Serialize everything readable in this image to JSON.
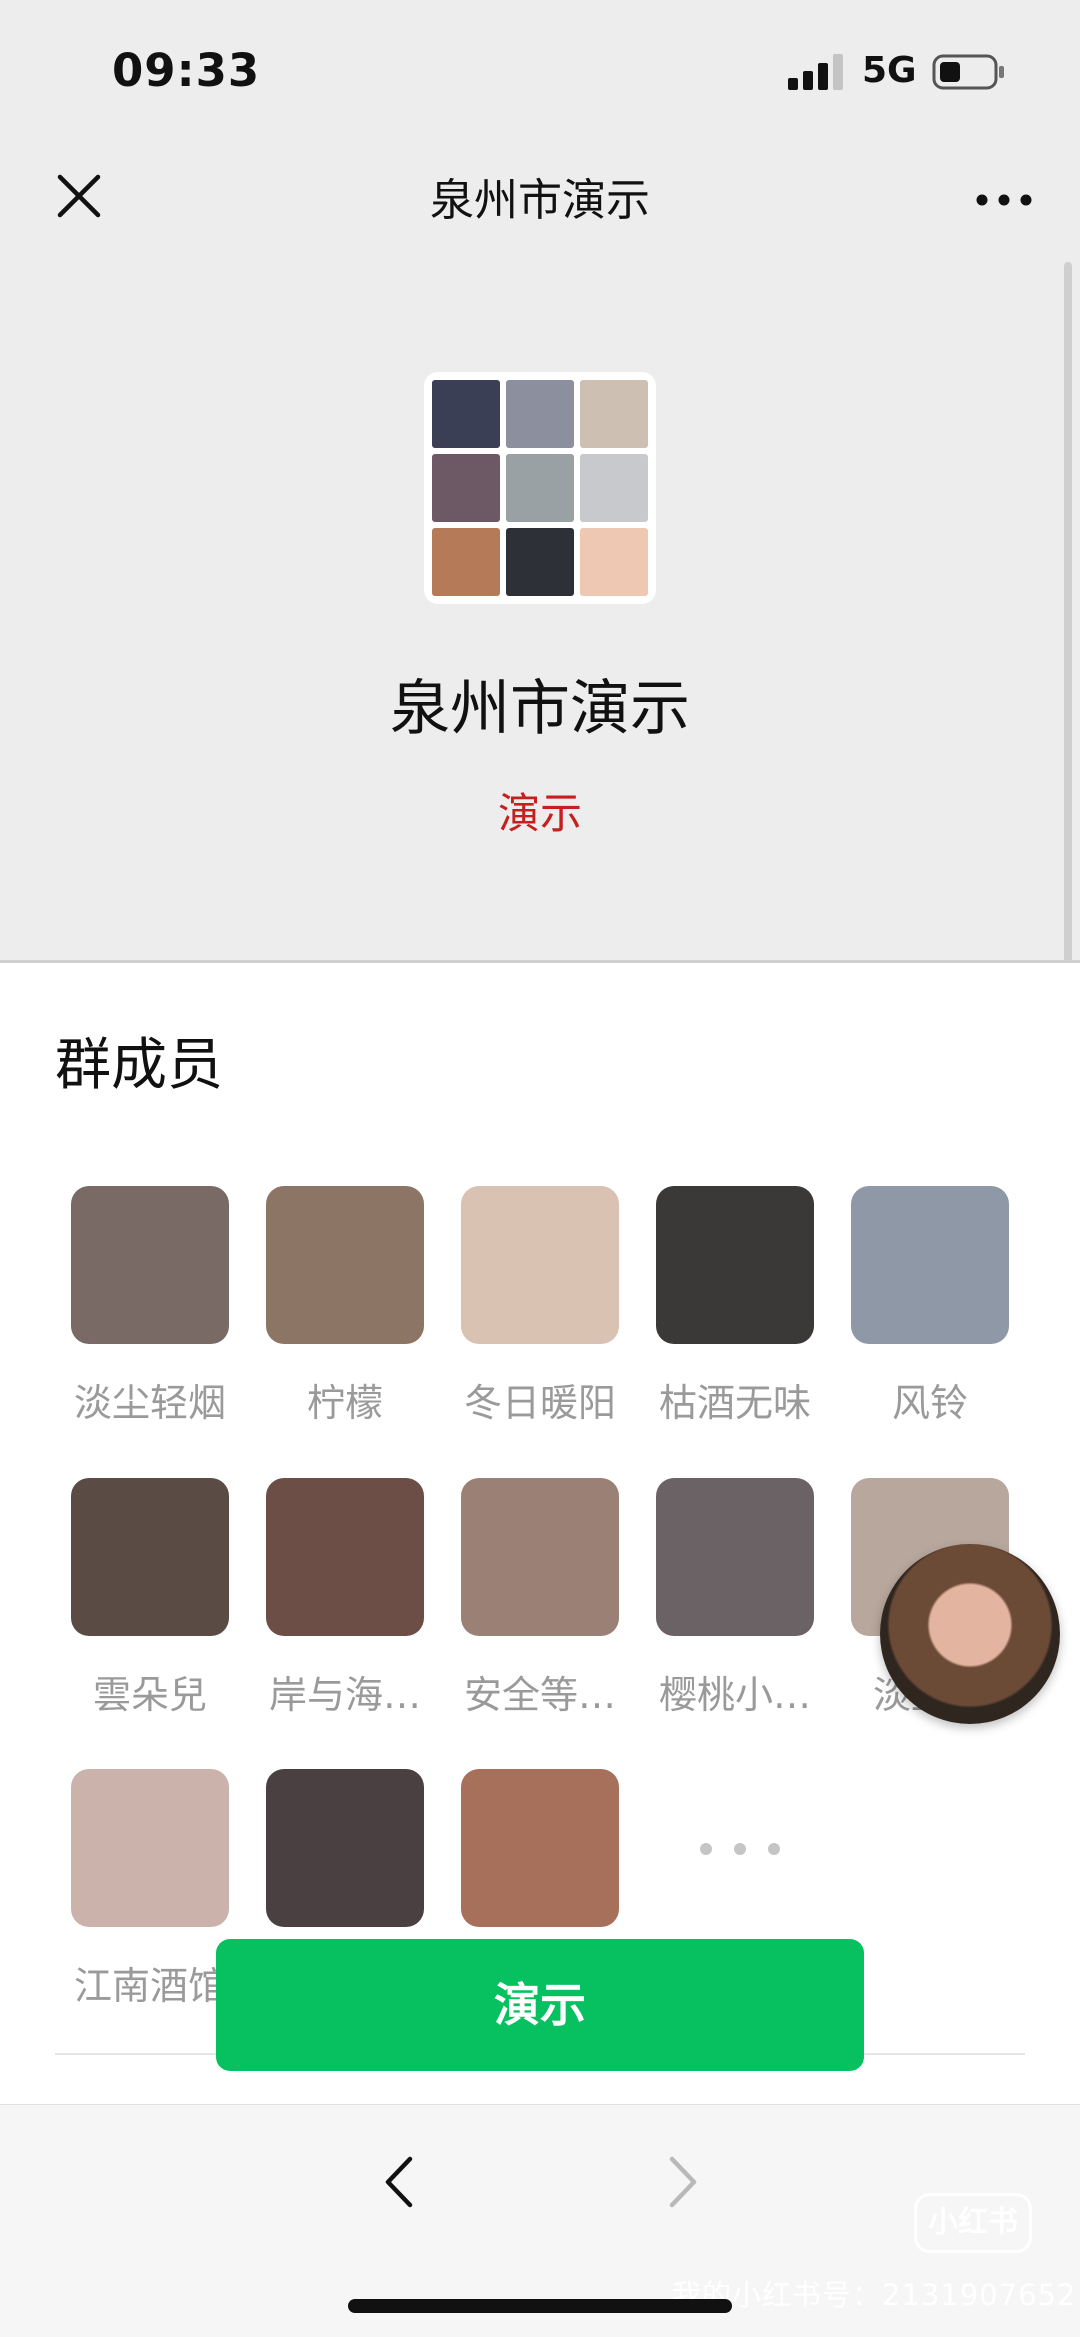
{
  "status_bar": {
    "time": "09:33",
    "network": "5G"
  },
  "nav": {
    "title": "泉州市演示",
    "close_icon": "close-icon",
    "more_icon": "more-dots-icon"
  },
  "group": {
    "name": "泉州市演示",
    "description": "演示",
    "avatar_tiles": [
      "#3a3f55",
      "#8c8f9e",
      "#cdbfb2",
      "#6d5866",
      "#9aa1a5",
      "#c8c9cc",
      "#b57a58",
      "#2e3038",
      "#efc8b4"
    ]
  },
  "members": {
    "heading": "群成员",
    "items": [
      {
        "name": "淡尘轻烟",
        "photo": "#7a6a66"
      },
      {
        "name": "柠檬",
        "photo": "#8d7566"
      },
      {
        "name": "冬日暖阳",
        "photo": "#d9c2b1"
      },
      {
        "name": "枯酒无味",
        "photo": "#3b3838"
      },
      {
        "name": "风铃",
        "photo": "#8e98a6"
      },
      {
        "name": "雲朵兒",
        "photo": "#5a4b45"
      },
      {
        "name": "岸与海…",
        "photo": "#6c4e47"
      },
      {
        "name": "安全等…",
        "photo": "#9b8175"
      },
      {
        "name": "樱桃小…",
        "photo": "#6b6266"
      },
      {
        "name": "淡尘…",
        "photo": "#b8a79c"
      },
      {
        "name": "江南酒馆",
        "photo": "#cbb3ac"
      },
      {
        "name": "",
        "photo": "#4a4042"
      },
      {
        "name": "",
        "photo": "#a6705a"
      }
    ]
  },
  "primary_button": {
    "label": "演示"
  },
  "toolbar": {
    "back_icon": "chevron-left-icon",
    "forward_icon": "chevron-right-icon"
  },
  "watermark": {
    "logo": "小红书",
    "text": "我的小红书号：2131907652"
  }
}
